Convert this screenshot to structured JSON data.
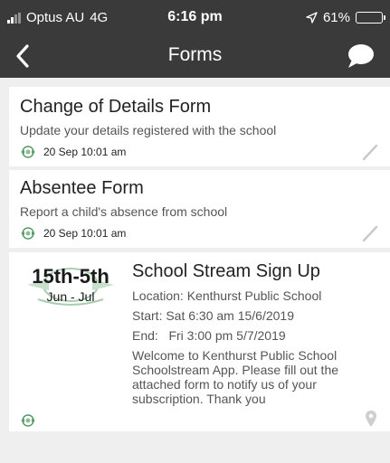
{
  "status_bar": {
    "carrier": "Optus AU",
    "network": "4G",
    "time": "6:16 pm",
    "battery": "61%",
    "battery_level": 0.61
  },
  "nav": {
    "title": "Forms",
    "back_icon": "chevron-left-icon",
    "chat_icon": "speech-bubble-icon"
  },
  "forms": [
    {
      "title": "Change of Details Form",
      "description": "Update your details registered with the school",
      "date": "20 Sep 10:01 am"
    },
    {
      "title": "Absentee Form",
      "description": "Report a child's absence from school",
      "date": "20 Sep 10:01 am"
    }
  ],
  "event": {
    "thumb_dates": "15th-5th",
    "thumb_months": "Jun - Jul",
    "title": "School Stream Sign Up",
    "location": "Location: Kenthurst Public School",
    "start": "Start: Sat 6:30 am 15/6/2019",
    "end": "End:   Fri 3:00 pm 5/7/2019",
    "description": "Welcome to Kenthurst Public School Schoolstream App. Please fill out the attached form to notify us of your subscription. Thank you"
  },
  "colors": {
    "header": "#3a3a3a",
    "background": "#efefef",
    "card": "#ffffff",
    "crest": "#5a9a6a"
  }
}
